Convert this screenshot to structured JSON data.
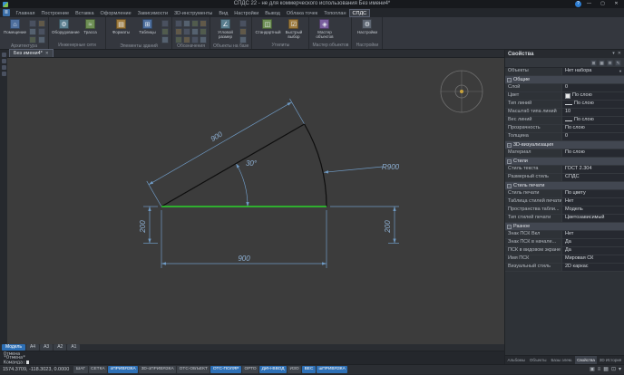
{
  "colors": {
    "accent": "#2d6fb5",
    "selected_line_green": "#2bd52b",
    "dimension_blue": "#8fb2d6",
    "canvas_background": "#3c3c3c"
  },
  "titlebar": {
    "title": "СПДС 22 - не для коммерческого использования Без имени4*",
    "help": "?",
    "minimize": "—",
    "maximize": "▢",
    "close": "✕"
  },
  "ribbon_tabs": [
    {
      "label": "Главная"
    },
    {
      "label": "Построение"
    },
    {
      "label": "Вставка"
    },
    {
      "label": "Оформление"
    },
    {
      "label": "Зависимости"
    },
    {
      "label": "3D-инструменты"
    },
    {
      "label": "Вид"
    },
    {
      "label": "Настройки"
    },
    {
      "label": "Вывод"
    },
    {
      "label": "Облака точек"
    },
    {
      "label": "Топоплан"
    },
    {
      "label": "СПДС",
      "active": true
    }
  ],
  "ribbon_groups": [
    {
      "label": "Архитектура",
      "buttons": [
        {
          "label": "Помещение"
        }
      ]
    },
    {
      "label": "Инженерные сети",
      "buttons": [
        {
          "label": "Оборудование"
        },
        {
          "label": "Трасса"
        }
      ]
    },
    {
      "label": "Элементы зданий",
      "buttons": [
        {
          "label": "Форматы"
        },
        {
          "label": "Таблицы"
        }
      ]
    },
    {
      "label": "Обозначения",
      "buttons": []
    },
    {
      "label": "Объекты на базе",
      "buttons": [
        {
          "label": "Угловой размер"
        }
      ]
    },
    {
      "label": "Утилиты",
      "buttons": [
        {
          "label": "Стандартный"
        },
        {
          "label": "Быстрый выбор"
        }
      ]
    },
    {
      "label": "Мастер объектов",
      "buttons": [
        {
          "label": "Мастер объектов"
        }
      ]
    },
    {
      "label": "Настройки",
      "buttons": [
        {
          "label": "Настройки"
        }
      ]
    }
  ],
  "document_tab": {
    "label": "Без имени4*",
    "close": "✕"
  },
  "drawing": {
    "dim_top": "900",
    "dim_angle": "30°",
    "dim_radius": "R900",
    "dim_left": "200",
    "dim_right": "200",
    "dim_bottom": "900"
  },
  "properties": {
    "title": "Свойства",
    "rows": [
      {
        "label": "Объекты",
        "value": "Нет набора"
      },
      {
        "label": "Общие"
      },
      {
        "label": "Слой",
        "value": "0"
      },
      {
        "label": "Цвет",
        "value": "По слою"
      },
      {
        "label": "Тип линий",
        "value": "По слою"
      },
      {
        "label": "Масштаб типа линий",
        "value": "10"
      },
      {
        "label": "Вес линий",
        "value": "По слою"
      },
      {
        "label": "Прозрачность",
        "value": "По слою"
      },
      {
        "label": "Толщина",
        "value": "0"
      },
      {
        "label": "3D-визуализация"
      },
      {
        "label": "Материал",
        "value": "По слою"
      },
      {
        "label": "Стили"
      },
      {
        "label": "Стиль текста",
        "value": "ГОСТ 2.304"
      },
      {
        "label": "Размерный стиль",
        "value": "СПДС"
      },
      {
        "label": "Стиль печати"
      },
      {
        "label": "Стиль печати",
        "value": "По цвету"
      },
      {
        "label": "Таблица стилей печати",
        "value": "Нет"
      },
      {
        "label": "Пространства табли...",
        "value": "Модель"
      },
      {
        "label": "Тип стилей печати",
        "value": "Цветозависимый"
      },
      {
        "label": "Разное"
      },
      {
        "label": "Знак ПСК Вкл",
        "value": "Нет"
      },
      {
        "label": "Знак ПСК в начале...",
        "value": "Да"
      },
      {
        "label": "ПСК в видовом экране",
        "value": "Да"
      },
      {
        "label": "Имя ПСК",
        "value": "Мировая СК"
      },
      {
        "label": "Визуальный стиль",
        "value": "2D каркас"
      }
    ],
    "bottom_tabs": [
      {
        "label": "Альбомы"
      },
      {
        "label": "Объекты"
      },
      {
        "label": "Базы элем."
      },
      {
        "label": "Свойства",
        "active": true
      },
      {
        "label": "3D История"
      }
    ]
  },
  "layout_tabs": [
    {
      "label": "Модель",
      "active": true
    },
    {
      "label": "А4"
    },
    {
      "label": "А3"
    },
    {
      "label": "А2"
    },
    {
      "label": "А1"
    }
  ],
  "command": {
    "history": [
      "Отмена",
      "*Отмена*"
    ],
    "prompt": "Команда:"
  },
  "statusbar": {
    "coords": "1574.3709, -118.3023, 0.0000",
    "buttons": [
      {
        "label": "ШАГ",
        "active": false
      },
      {
        "label": "СЕТКА",
        "active": false
      },
      {
        "label": "оПРИВЯЗКА",
        "active": true
      },
      {
        "label": "3D-оПРИВЯЗКА",
        "active": false
      },
      {
        "label": "ОТС-ОБЪЕКТ",
        "active": false
      },
      {
        "label": "ОТС-ПОЛЯР",
        "active": true
      },
      {
        "label": "ОРТО",
        "active": false
      },
      {
        "label": "ДИН-ВВОД",
        "active": true
      },
      {
        "label": "ИЗО",
        "active": false
      },
      {
        "label": "ВЕС",
        "active": true
      },
      {
        "label": "шПРИВЯЗКА",
        "active": true
      }
    ]
  }
}
